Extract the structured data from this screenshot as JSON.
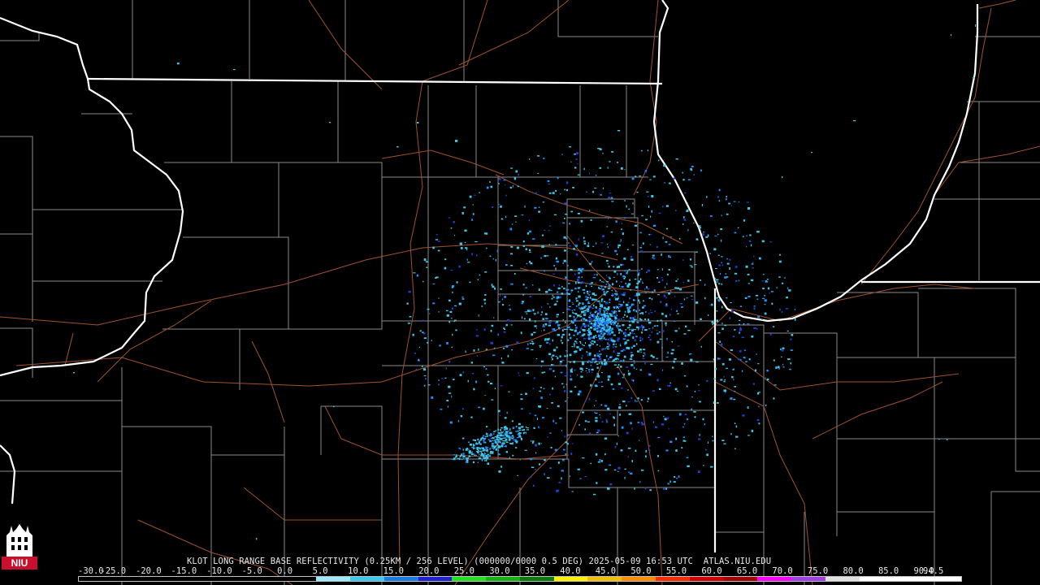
{
  "product": {
    "title": "KLOT LONG RANGE BASE REFLECTIVITY (0.25KM / 256 LEVEL) (000000/0000 0.5 DEG) 2025-05-09 16:53 UTC  ATLAS.NIU.EDU",
    "radar_site": "KLOT",
    "date": "2025-05-09",
    "time": "16:53 UTC",
    "elevation": "0.5 DEG",
    "source": "ATLAS.NIU.EDU"
  },
  "scale": {
    "ticks": [
      "-30.0",
      "-25.0",
      "-20.0",
      "-15.0",
      "-10.0",
      "-5.0",
      "0.0",
      "5.0",
      "10.0",
      "15.0",
      "20.0",
      "25.0",
      "30.0",
      "35.0",
      "40.0",
      "45.0",
      "50.0",
      "55.0",
      "60.0",
      "65.0",
      "70.0",
      "75.0",
      "80.0",
      "85.0",
      "90.0",
      "94.5"
    ],
    "colors": [
      "#000000",
      "#000000",
      "#000000",
      "#000000",
      "#000000",
      "#000000",
      "#000000",
      "#9be8ff",
      "#38c8f0",
      "#1a7ae6",
      "#2020d0",
      "#20e020",
      "#14b014",
      "#0a7a0a",
      "#fff200",
      "#f0c000",
      "#ff8c00",
      "#ff2a00",
      "#d00000",
      "#a00000",
      "#ff00ff",
      "#a040e0",
      "#e0e0e0",
      "#ffffff",
      "#ffffff",
      "#ffffff"
    ]
  },
  "map": {
    "lake_name": "",
    "legend_colors": {
      "state_border": "#ffffff",
      "county_border": "#8c8c8c",
      "highway": "#a0522d",
      "echo_light": "#3ec8e8",
      "echo_mid": "#1e90ff",
      "echo_dark": "#2040d0"
    }
  },
  "logo": {
    "text": "NIU",
    "color": "#c8102e"
  }
}
